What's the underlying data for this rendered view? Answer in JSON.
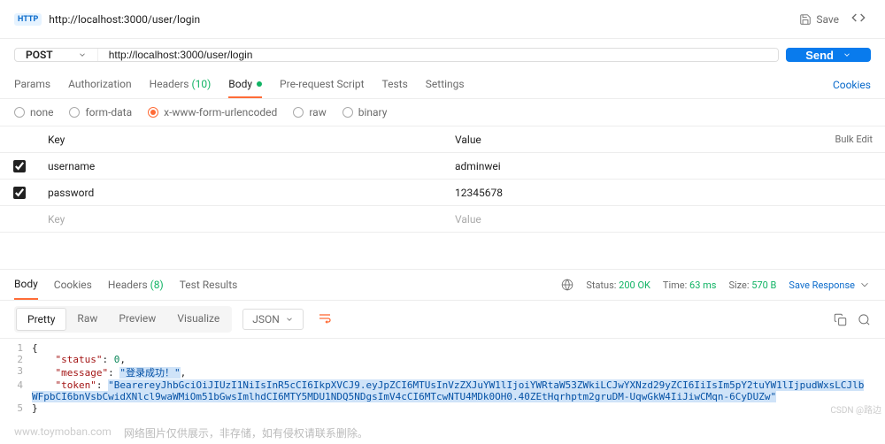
{
  "header": {
    "badge": "HTTP",
    "url": "http://localhost:3000/user/login",
    "save": "Save"
  },
  "request": {
    "method": "POST",
    "url": "http://localhost:3000/user/login",
    "send": "Send"
  },
  "tabs": {
    "params": "Params",
    "auth": "Authorization",
    "headers": "Headers",
    "headers_count": "(10)",
    "body": "Body",
    "prereq": "Pre-request Script",
    "tests": "Tests",
    "settings": "Settings",
    "cookies": "Cookies"
  },
  "bodytypes": {
    "none": "none",
    "form": "form-data",
    "url": "x-www-form-urlencoded",
    "raw": "raw",
    "binary": "binary"
  },
  "kv": {
    "key_h": "Key",
    "val_h": "Value",
    "bulk": "Bulk Edit",
    "rows": [
      {
        "key": "username",
        "value": "adminwei"
      },
      {
        "key": "password",
        "value": "12345678"
      }
    ],
    "empty_key": "Key",
    "empty_val": "Value"
  },
  "resp": {
    "body": "Body",
    "cookies": "Cookies",
    "headers": "Headers",
    "headers_count": "(8)",
    "test": "Test Results",
    "status_l": "Status:",
    "status_v": "200 OK",
    "time_l": "Time:",
    "time_v": "63 ms",
    "size_l": "Size:",
    "size_v": "570 B",
    "save": "Save Response"
  },
  "viewer": {
    "pretty": "Pretty",
    "raw": "Raw",
    "preview": "Preview",
    "visualize": "Visualize",
    "json": "JSON"
  },
  "json_body": {
    "status": 0,
    "message": "登录成功！",
    "token": "BearereyJhbGciOiJIUzI1NiIsInR5cCI6IkpXVCJ9.eyJpZCI6MTUsInVzZXJuYW1lIjoiYWRtaW53ZWkiLCJwYXNzd29yZCI6IiIsIm5pY2tuYW1lIjpudWxsLCJlbWFpbCI6bnVsbCwidXNlcl9waWMiOm51bGwsImlhdCI6MTY5MDU1NDQ5NDgsImV4cCI6MTcwNTU4MDk0OH0.40ZEtHqrhptm2gruDM-UqwGkW4IiJiwCMqn-6CyDUZw"
  },
  "footer": {
    "wm": "www.toymoban.com",
    "txt": "网络图片仅供展示，非存储，如有侵权请联系删除。",
    "csdn": "CSDN @路边"
  }
}
